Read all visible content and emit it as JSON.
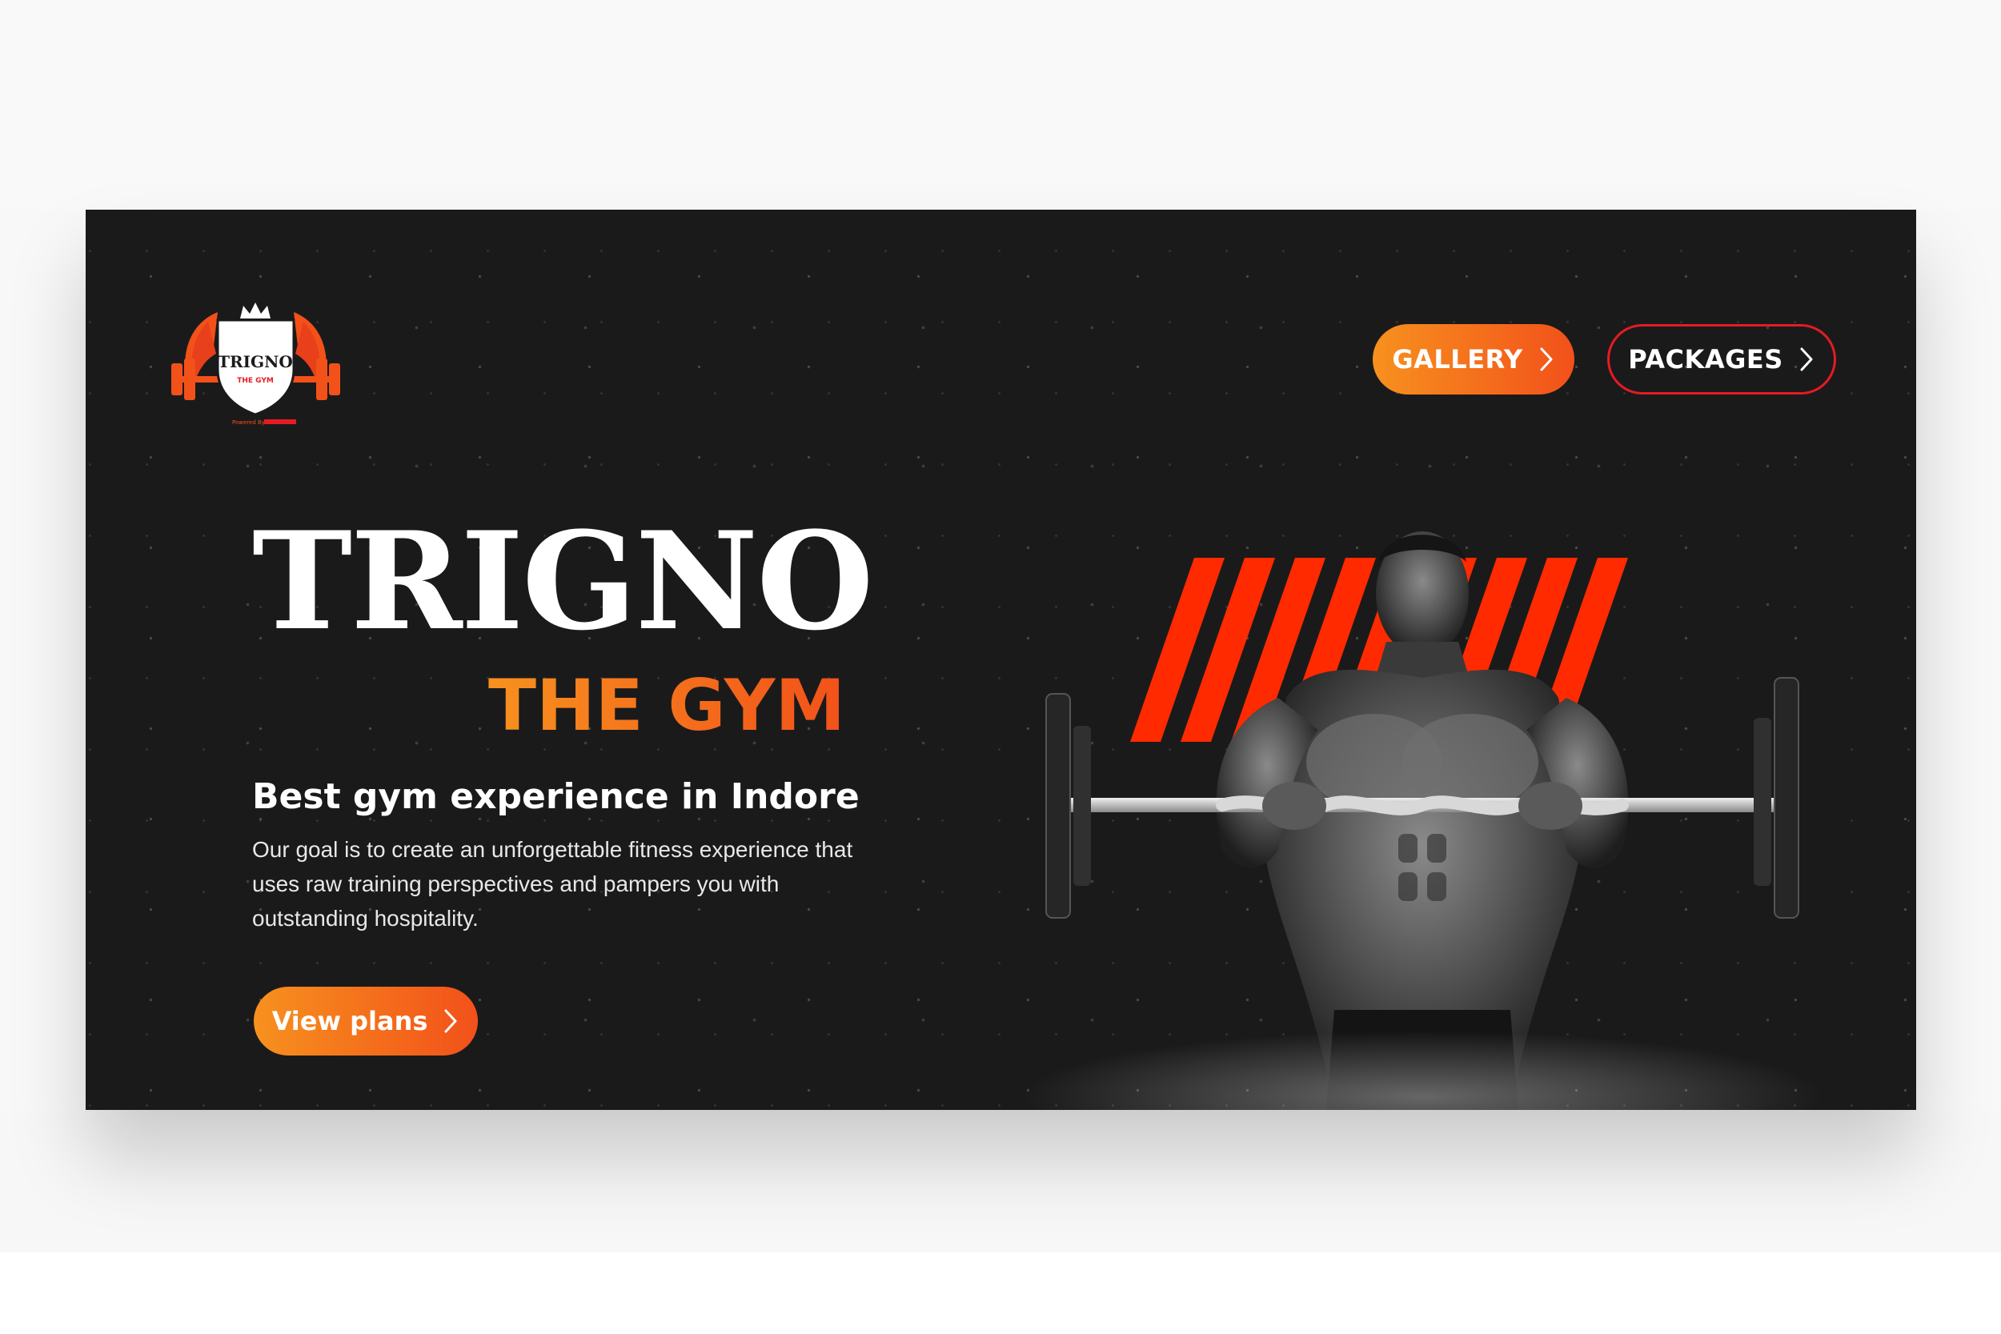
{
  "logo": {
    "name": "TRIGNO",
    "sub": "THE GYM",
    "powered": "Powered By"
  },
  "nav": {
    "gallery_label": "GALLERY",
    "packages_label": "PACKAGES"
  },
  "hero": {
    "title": "TRIGNO",
    "subtitle": "THE GYM",
    "tagline": "Best gym experience in Indore",
    "description": "Our goal is to create an unforgettable fitness experience that uses raw training perspectives and pampers you with outstanding hospitality.",
    "cta_label": "View plans"
  },
  "icons": {
    "nav_chevron": "chevron-right-icon",
    "cta_chevron": "chevron-right-icon",
    "logo": "gym-crest-logo"
  },
  "colors": {
    "background": "#1b1a1b",
    "accent_orange": "#f7911e",
    "accent_red_orange": "#f2511a",
    "stripe_red": "#ff2a00",
    "outline_red": "#e51b23",
    "text": "#ffffff"
  }
}
